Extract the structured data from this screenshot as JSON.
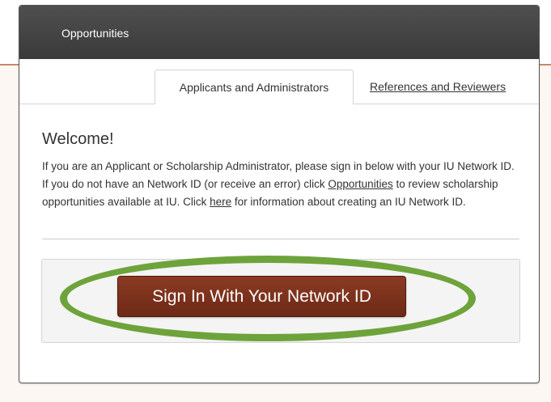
{
  "header": {
    "title": "Opportunities"
  },
  "tabs": [
    {
      "label": "Applicants and Administrators",
      "active": true
    },
    {
      "label": "References and Reviewers",
      "active": false
    }
  ],
  "welcome": {
    "title": "Welcome!",
    "text_1": "If you are an Applicant or Scholarship Administrator, please sign in below with your IU Network ID. If you do not have an Network ID (or receive an error) click ",
    "link_opportunities": "Opportunities",
    "text_2": " to review scholarship opportunities available at IU. Click ",
    "link_here": "here",
    "text_3": " for information about creating an IU Network ID."
  },
  "signin": {
    "button_label": "Sign In With Your Network ID"
  },
  "colors": {
    "header_bg": "#454545",
    "button_bg": "#7b3220",
    "highlight_ring": "#6ea33b",
    "accent_line": "#c98a63"
  }
}
